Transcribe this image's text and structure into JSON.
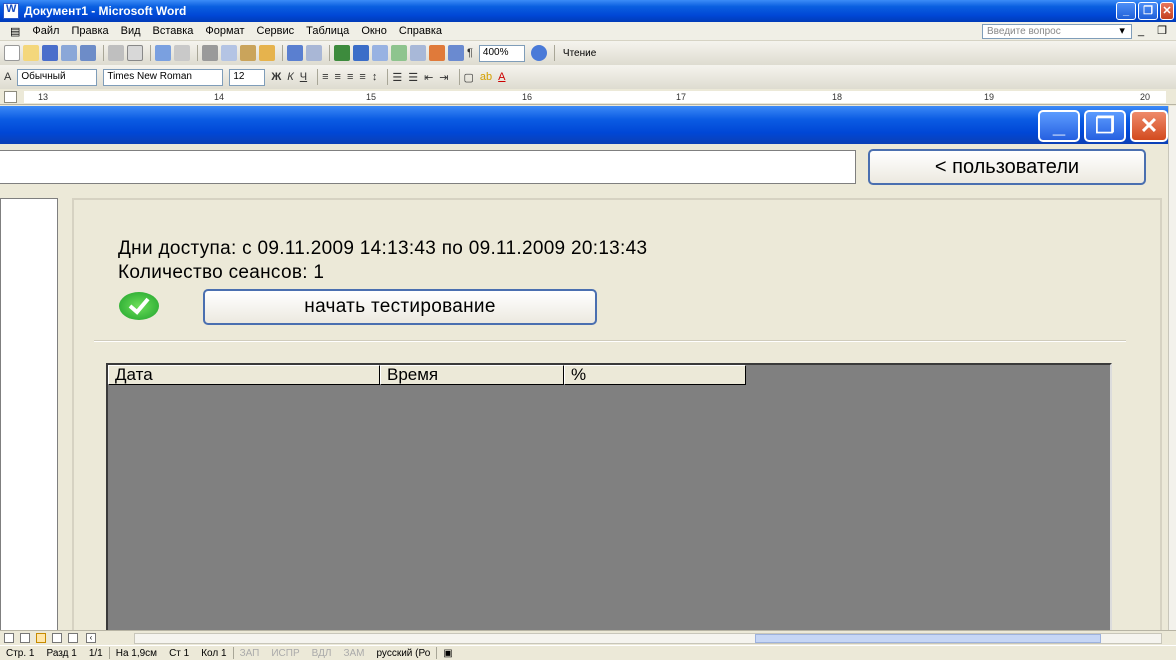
{
  "word": {
    "title": "Документ1 - Microsoft Word",
    "menu": [
      "Файл",
      "Правка",
      "Вид",
      "Вставка",
      "Формат",
      "Сервис",
      "Таблица",
      "Окно",
      "Справка"
    ],
    "help_placeholder": "Введите вопрос",
    "zoom": "400%",
    "reading_label": "Чтение",
    "style_value": "Обычный",
    "font_value": "Times New Roman",
    "size_value": "12",
    "ruler_numbers": [
      "13",
      "14",
      "15",
      "16",
      "17",
      "18",
      "19",
      "20"
    ]
  },
  "app": {
    "users_button": "< пользователи",
    "access_days": "Дни доступа:  с 09.11.2009 14:13:43 по 09.11.2009 20:13:43",
    "session_count": "Количество сеансов: 1",
    "start_button": "начать тестирование",
    "columns": [
      "Дата",
      "Время",
      "%"
    ]
  },
  "status": {
    "page": "Стр. 1",
    "section": "Разд 1",
    "pages": "1/1",
    "at": "На 1,9см",
    "line": "Ст 1",
    "col": "Кол 1",
    "rec": "ЗАП",
    "trk": "ИСПР",
    "ext": "ВДЛ",
    "ovr": "ЗАМ",
    "language": "русский (Ро"
  },
  "colors": {
    "xp_blue": "#0047d6",
    "grid_bg": "#808080",
    "window_bg": "#ece9d8"
  }
}
